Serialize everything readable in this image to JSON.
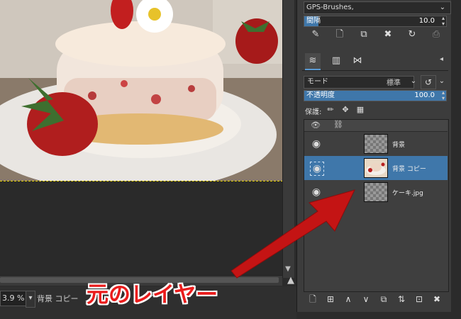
{
  "brush": {
    "name": "GPS-Brushes,"
  },
  "spacing": {
    "label": "間隔",
    "value": "10.0"
  },
  "layers_panel": {
    "mode_label": "モード",
    "mode_value": "標準",
    "opacity_label": "不透明度",
    "opacity_value": "100.0",
    "lock_label": "保護:",
    "layers": [
      {
        "name": "背景",
        "selected": false
      },
      {
        "name": "背景 コピー",
        "selected": true
      },
      {
        "name": "ケーキ.jpg",
        "selected": false
      }
    ]
  },
  "status": {
    "zoom": "3.9 %",
    "text": "背景 コピー"
  },
  "annotation": {
    "text": "元のレイヤー"
  },
  "colors": {
    "selection": "#3f77aa",
    "annotation": "#ea1c1c",
    "dock_bg": "#3c3c3c"
  }
}
